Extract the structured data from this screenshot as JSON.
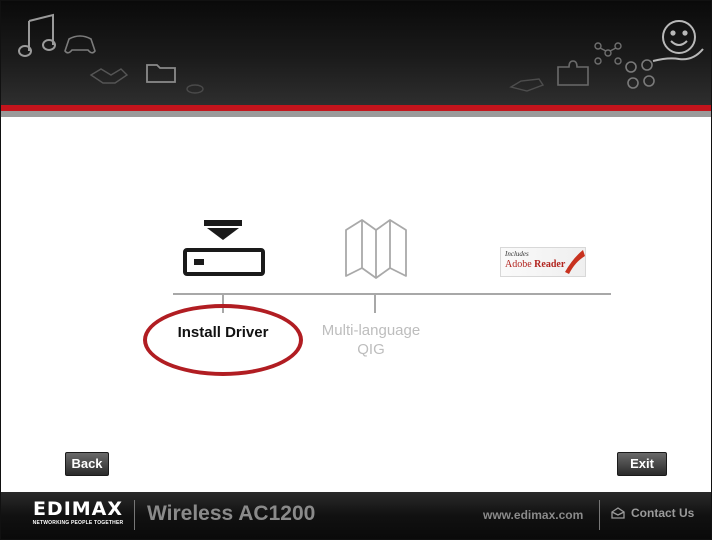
{
  "options": [
    {
      "label": "Install Driver",
      "selected": true
    },
    {
      "label": "Multi-language",
      "label2": "QIG",
      "selected": false
    }
  ],
  "adobe_badge": {
    "line1": "Includes",
    "line2": "Adobe",
    "line3": "Reader"
  },
  "buttons": {
    "back": "Back",
    "exit": "Exit"
  },
  "footer": {
    "brand": "EDIMAX",
    "tagline": "NETWORKING PEOPLE TOGETHER",
    "product": "Wireless AC1200",
    "website": "www.edimax.com",
    "contact": "Contact Us"
  },
  "colors": {
    "accent_red": "#c3141c",
    "highlight_circle": "#b11d22"
  },
  "icons": [
    "music-icon",
    "gamepad-icon",
    "handshake-icon",
    "folder-icon",
    "puzzle-icon",
    "molecule-icon",
    "smiley-icon",
    "install-driver-icon",
    "map-icon",
    "adobe-reader-icon",
    "mail-icon"
  ]
}
